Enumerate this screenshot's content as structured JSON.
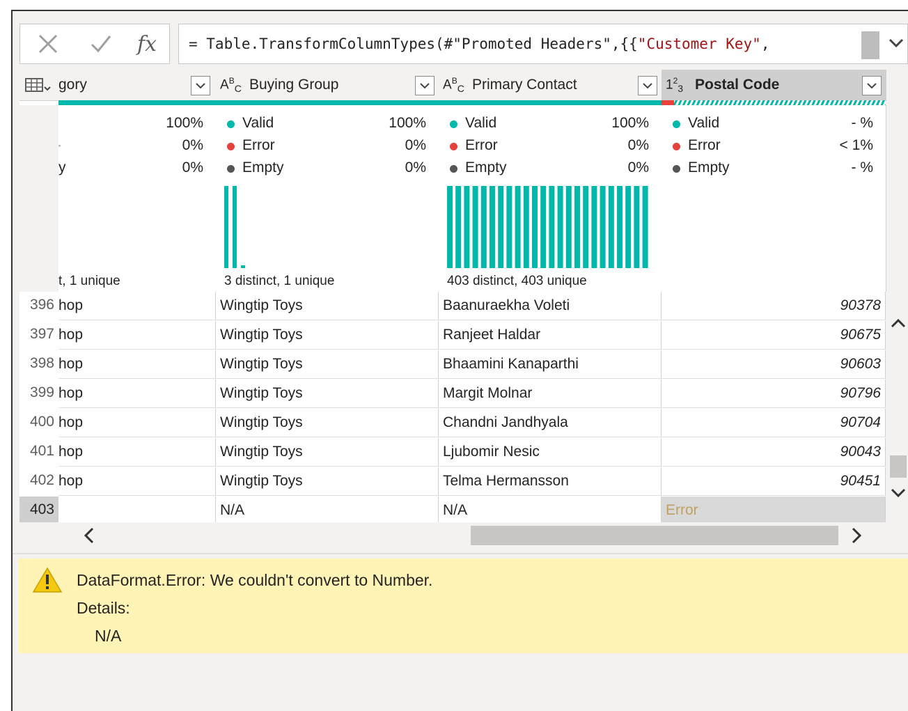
{
  "formula_bar": {
    "cancel_icon": "x-icon",
    "confirm_icon": "check-icon",
    "fx_label": "fx",
    "formula_prefix": "= Table.TransformColumnTypes(#\"Promoted Headers\",{{",
    "formula_string": "\"Customer Key\"",
    "formula_suffix": ","
  },
  "columns": [
    {
      "name": "gory",
      "type_icon": "table-icon"
    },
    {
      "name": "Buying Group",
      "type_icon": "text-type-icon"
    },
    {
      "name": "Primary Contact",
      "type_icon": "text-type-icon"
    },
    {
      "name": "Postal Code",
      "type_icon": "number-type-icon"
    }
  ],
  "profiles": [
    {
      "valid": "100%",
      "error": "0%",
      "empty": "0%",
      "valid_frag": "",
      "error_frag": "·",
      "empty_frag": "y",
      "distinct": "t, 1 unique"
    },
    {
      "valid_label": "Valid",
      "error_label": "Error",
      "empty_label": "Empty",
      "valid": "100%",
      "error": "0%",
      "empty": "0%",
      "distinct": "3 distinct, 1 unique"
    },
    {
      "valid_label": "Valid",
      "error_label": "Error",
      "empty_label": "Empty",
      "valid": "100%",
      "error": "0%",
      "empty": "0%",
      "distinct": "403 distinct, 403 unique"
    },
    {
      "valid_label": "Valid",
      "error_label": "Error",
      "empty_label": "Empty",
      "valid": "- %",
      "error": "< 1%",
      "empty": "- %",
      "distinct": ""
    }
  ],
  "rows": [
    {
      "num": "396",
      "c1": "hop",
      "c2": "Wingtip Toys",
      "c3": "Baanuraekha Voleti",
      "c4": "90378"
    },
    {
      "num": "397",
      "c1": "hop",
      "c2": "Wingtip Toys",
      "c3": "Ranjeet Haldar",
      "c4": "90675"
    },
    {
      "num": "398",
      "c1": "hop",
      "c2": "Wingtip Toys",
      "c3": "Bhaamini Kanaparthi",
      "c4": "90603"
    },
    {
      "num": "399",
      "c1": "hop",
      "c2": "Wingtip Toys",
      "c3": "Margit Molnar",
      "c4": "90796"
    },
    {
      "num": "400",
      "c1": "hop",
      "c2": "Wingtip Toys",
      "c3": "Chandni Jandhyala",
      "c4": "90704"
    },
    {
      "num": "401",
      "c1": "hop",
      "c2": "Wingtip Toys",
      "c3": "Ljubomir Nesic",
      "c4": "90043"
    },
    {
      "num": "402",
      "c1": "hop",
      "c2": "Wingtip Toys",
      "c3": "Telma Hermansson",
      "c4": "90451"
    },
    {
      "num": "403",
      "c1": "",
      "c2": "N/A",
      "c3": "N/A",
      "c4": "Error"
    }
  ],
  "error_pane": {
    "icon": "warning-icon",
    "message": "DataFormat.Error: We couldn't convert to Number.",
    "details_label": "Details:",
    "details_value": "N/A"
  },
  "colors": {
    "valid": "#01b8aa",
    "error": "#e8413b",
    "empty": "#555555",
    "error_pane_bg": "#fff4b6"
  }
}
